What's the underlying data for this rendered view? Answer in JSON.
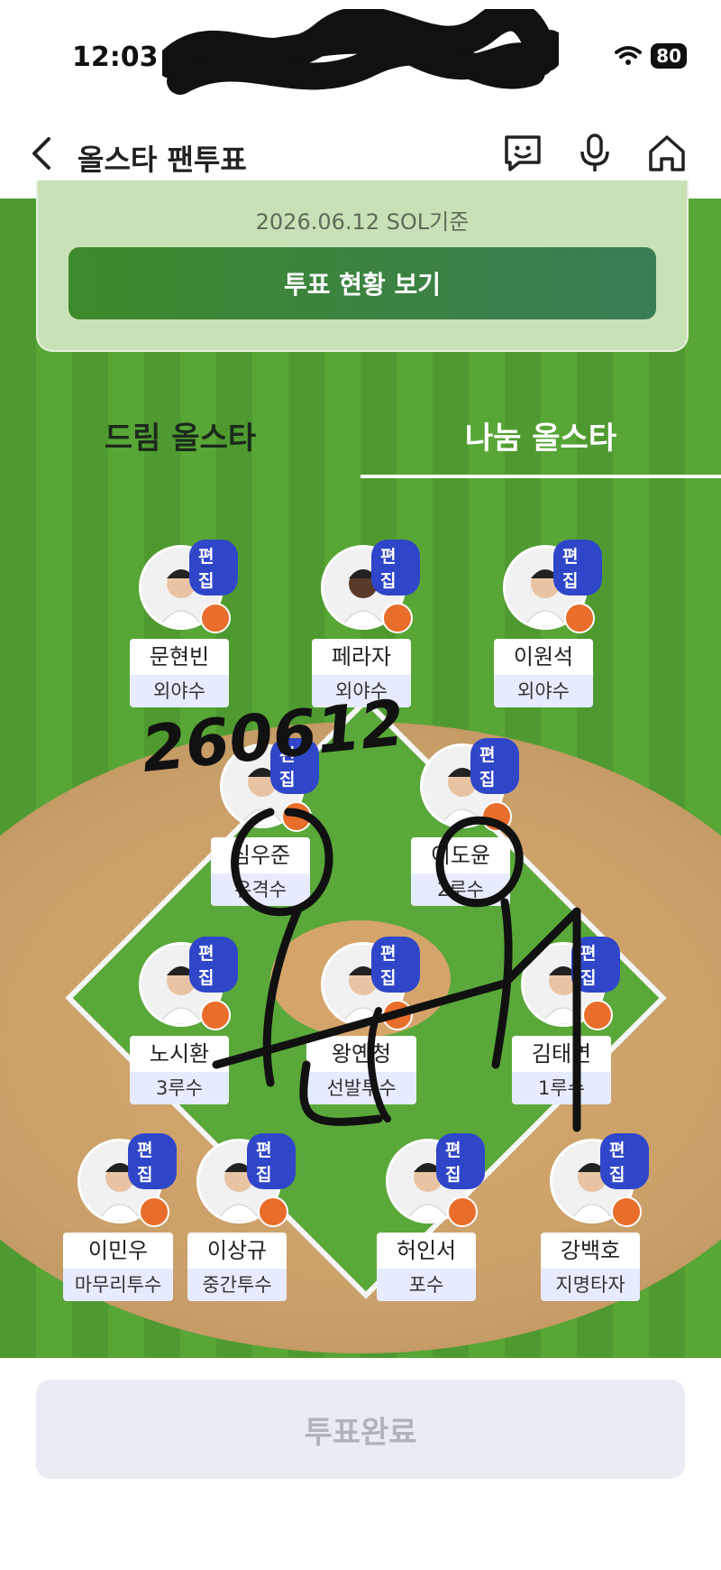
{
  "status": {
    "time": "12:03",
    "battery": "80"
  },
  "nav": {
    "title": "올스타 팬투표"
  },
  "summary": {
    "date_text": "2026.06.12 SOL기준",
    "button_label": "투표 현황 보기"
  },
  "tabs": [
    {
      "label": "드림 올스타"
    },
    {
      "label": "나눔 올스타",
      "active": true
    }
  ],
  "edit_label": "편집",
  "players": [
    {
      "name": "문현빈",
      "position": "외야수"
    },
    {
      "name": "페라자",
      "position": "외야수"
    },
    {
      "name": "이원석",
      "position": "외야수"
    },
    {
      "name": "심우준",
      "position": "유격수"
    },
    {
      "name": "이도윤",
      "position": "2루수"
    },
    {
      "name": "노시환",
      "position": "3루수"
    },
    {
      "name": "왕옌청",
      "position": "선발투수"
    },
    {
      "name": "김태연",
      "position": "1루수"
    },
    {
      "name": "이민우",
      "position": "마무리투수"
    },
    {
      "name": "이상규",
      "position": "중간투수"
    },
    {
      "name": "허인서",
      "position": "포수"
    },
    {
      "name": "강백호",
      "position": "지명타자"
    }
  ],
  "handwriting": {
    "text": "260612"
  },
  "footer": {
    "button_label": "투표완료"
  },
  "colors": {
    "field_green": "#57a636",
    "edit_badge": "#2f46c9",
    "team_logo": "#e96d2b",
    "accent_button": "#3e8a2c"
  }
}
